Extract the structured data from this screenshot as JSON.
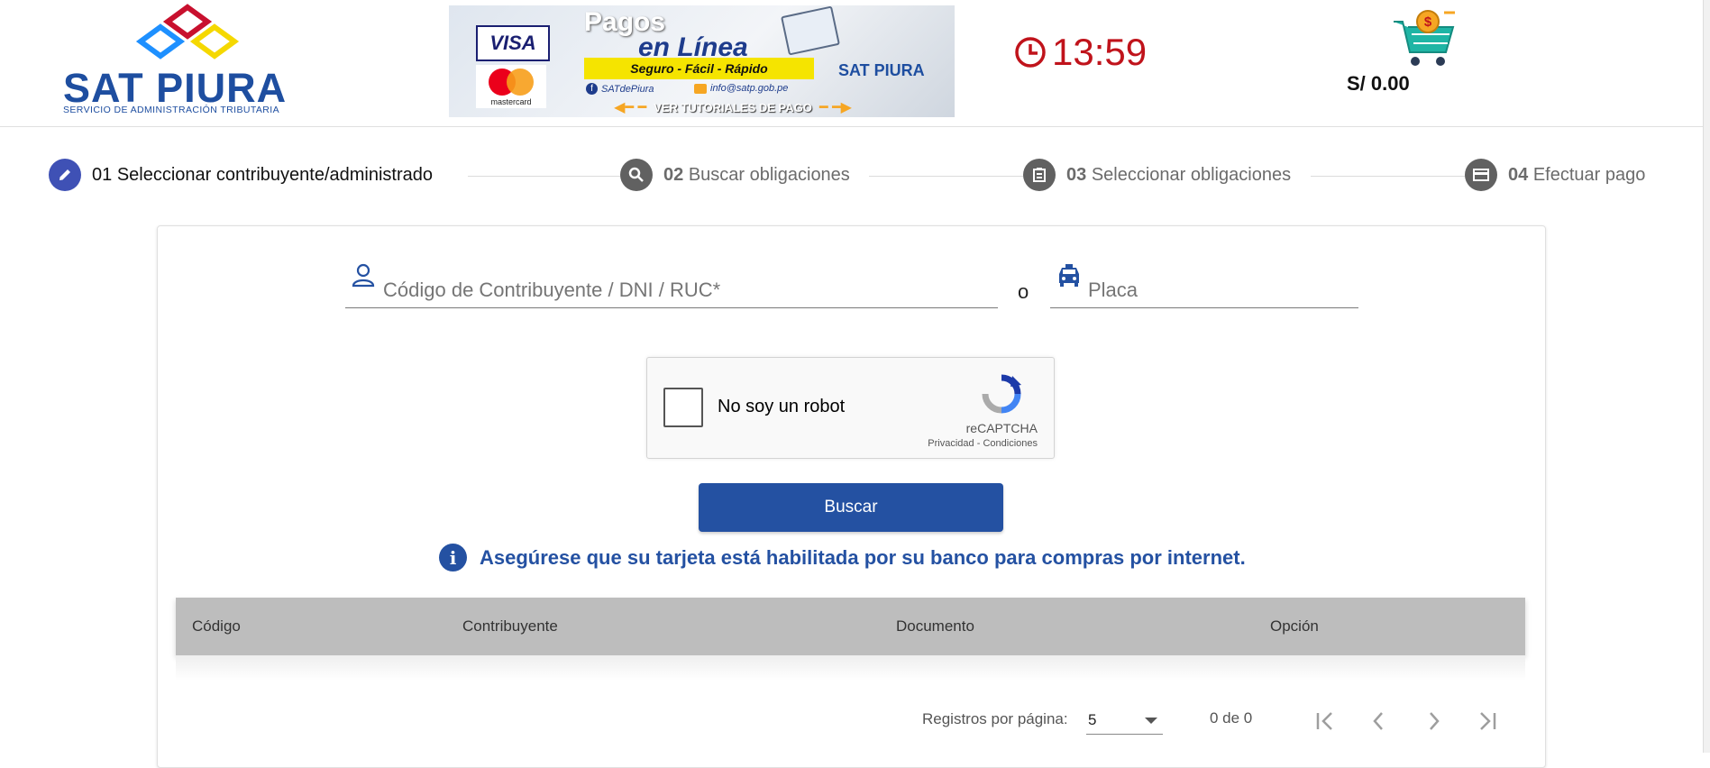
{
  "header": {
    "logo_title": "SAT PIURA",
    "logo_subtitle": "SERVICIO DE ADMINISTRACIÓN TRIBUTARIA",
    "banner": {
      "title_line1": "Pagos",
      "title_line2": "en Línea",
      "tagline": "Seguro - Fácil - Rápido",
      "facebook": "SATdePiura",
      "email": "info@satp.gob.pe",
      "brand": "SAT PIURA",
      "tutorials": "VER TUTORIALES DE PAGO",
      "card1": "VISA",
      "card2": "mastercard"
    },
    "timer": "13:59",
    "cart_total": "S/ 0.00",
    "cart_badge": "$"
  },
  "stepper": [
    {
      "num": "01",
      "label": "Seleccionar contribuyente/administrado",
      "icon": "pencil-icon",
      "active": true
    },
    {
      "num": "02",
      "label": "Buscar obligaciones",
      "icon": "search-icon",
      "active": false
    },
    {
      "num": "03",
      "label": "Seleccionar obligaciones",
      "icon": "list-icon",
      "active": false
    },
    {
      "num": "04",
      "label": "Efectuar pago",
      "icon": "credit-card-icon",
      "active": false
    }
  ],
  "form": {
    "taxpayer_placeholder": "Código de Contribuyente / DNI / RUC*",
    "or_text": "o",
    "plate_placeholder": "Placa"
  },
  "captcha": {
    "label": "No soy un robot",
    "brand": "reCAPTCHA",
    "privacy": "Privacidad",
    "sep": "-",
    "terms": "Condiciones"
  },
  "search_button": "Buscar",
  "notice": "Asegúrese que su tarjeta está habilitada por su banco para compras por internet.",
  "table": {
    "columns": [
      "Código",
      "Contribuyente",
      "Documento",
      "Opción"
    ],
    "rows": []
  },
  "paginator": {
    "label": "Registros por página:",
    "page_size": "5",
    "range": "0 de 0"
  },
  "colors": {
    "primary": "#2451a2",
    "step_active": "#3f51b5",
    "step_inactive": "#616161",
    "timer": "#c0131b",
    "table_header": "#bdbdbd"
  }
}
